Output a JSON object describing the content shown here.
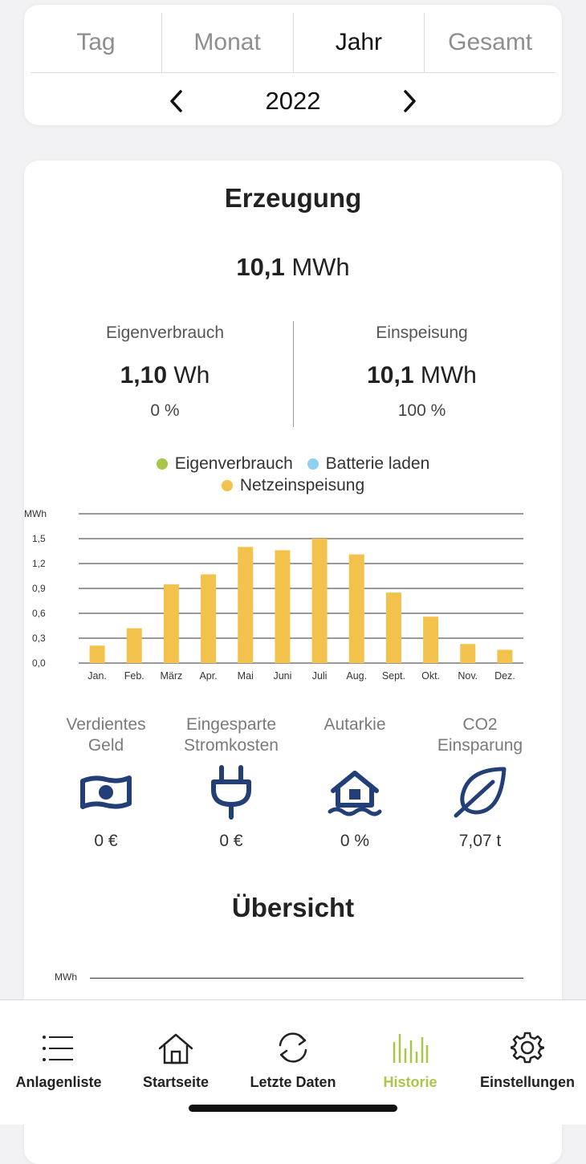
{
  "period": {
    "tabs": [
      "Tag",
      "Monat",
      "Jahr",
      "Gesamt"
    ],
    "active_tab": "Jahr",
    "year": "2022"
  },
  "production": {
    "title": "Erzeugung",
    "total_value": "10,1",
    "total_unit": "MWh",
    "self_consumption": {
      "label": "Eigenverbrauch",
      "value": "1,10",
      "unit": "Wh",
      "percent": "0 %"
    },
    "feed_in": {
      "label": "Einspeisung",
      "value": "10,1",
      "unit": "MWh",
      "percent": "100 %"
    }
  },
  "legend": [
    {
      "label": "Eigenverbrauch",
      "color": "#a8c64a"
    },
    {
      "label": "Batterie laden",
      "color": "#8fd0f0"
    },
    {
      "label": "Netzeinspeisung",
      "color": "#f3c24c"
    }
  ],
  "chart_data": {
    "type": "bar",
    "ylabel": "MWh",
    "ylim": [
      0,
      1.8
    ],
    "yticks": [
      "0,0",
      "0,3",
      "0,6",
      "0,9",
      "1,2",
      "1,5"
    ],
    "categories": [
      "Jan.",
      "Feb.",
      "März",
      "Apr.",
      "Mai",
      "Juni",
      "Juli",
      "Aug.",
      "Sept.",
      "Okt.",
      "Nov.",
      "Dez."
    ],
    "series": [
      {
        "name": "Netzeinspeisung",
        "color": "#f3c24c",
        "values": [
          0.21,
          0.42,
          0.95,
          1.07,
          1.4,
          1.36,
          1.5,
          1.31,
          0.85,
          0.56,
          0.23,
          0.16
        ]
      }
    ],
    "grid": true
  },
  "stats": [
    {
      "label_line1": "Verdientes",
      "label_line2": "Geld",
      "icon": "money-icon",
      "value": "0 €"
    },
    {
      "label_line1": "Eingesparte",
      "label_line2": "Stromkosten",
      "icon": "plug-icon",
      "value": "0 €"
    },
    {
      "label_line1": "Autarkie",
      "label_line2": "",
      "icon": "flooded-house-icon",
      "value": "0 %"
    },
    {
      "label_line1": "CO2",
      "label_line2": "Einsparung",
      "icon": "leaf-icon",
      "value": "7,07 t"
    }
  ],
  "overview": {
    "title": "Übersicht",
    "unit": "MWh"
  },
  "nav": [
    {
      "label": "Anlagenliste",
      "icon": "list-icon",
      "active": false
    },
    {
      "label": "Startseite",
      "icon": "home-icon",
      "active": false
    },
    {
      "label": "Letzte Daten",
      "icon": "refresh-icon",
      "active": false
    },
    {
      "label": "Historie",
      "icon": "history-chart-icon",
      "active": true
    },
    {
      "label": "Einstellungen",
      "icon": "gear-icon",
      "active": false
    }
  ],
  "colors": {
    "accent": "#a9c64a",
    "icon_blue": "#233f78",
    "bar": "#f3c24c"
  }
}
